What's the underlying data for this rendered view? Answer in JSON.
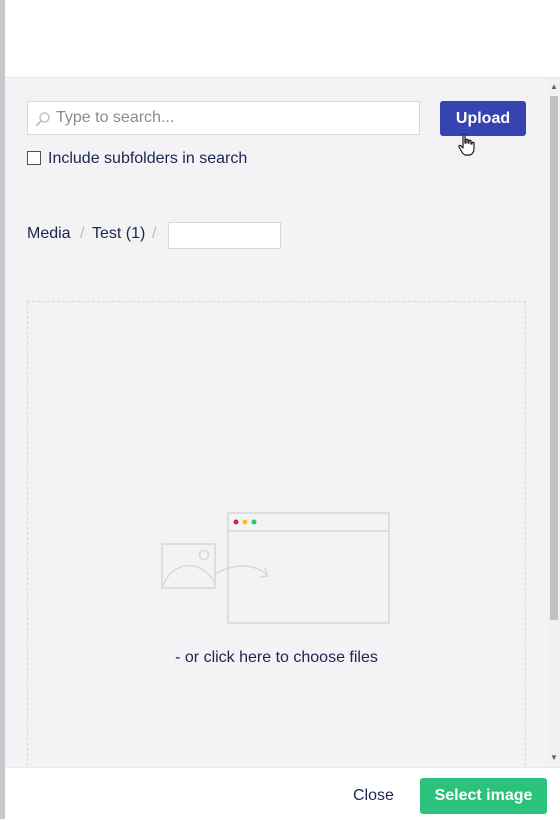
{
  "search": {
    "placeholder": "Type to search..."
  },
  "toolbar": {
    "upload_label": "Upload"
  },
  "options": {
    "include_subfolders_label": "Include subfolders in search",
    "include_subfolders_checked": false
  },
  "breadcrumb": {
    "items": [
      "Media",
      "Test (1)"
    ],
    "separator": "/",
    "new_folder_value": ""
  },
  "dropzone": {
    "text": "- or click here to choose files"
  },
  "footer": {
    "close_label": "Close",
    "select_label": "Select image"
  },
  "colors": {
    "primary": "#3544b1",
    "success": "#2bc37c",
    "text": "#1b264f",
    "panel": "#f3f3f5"
  }
}
